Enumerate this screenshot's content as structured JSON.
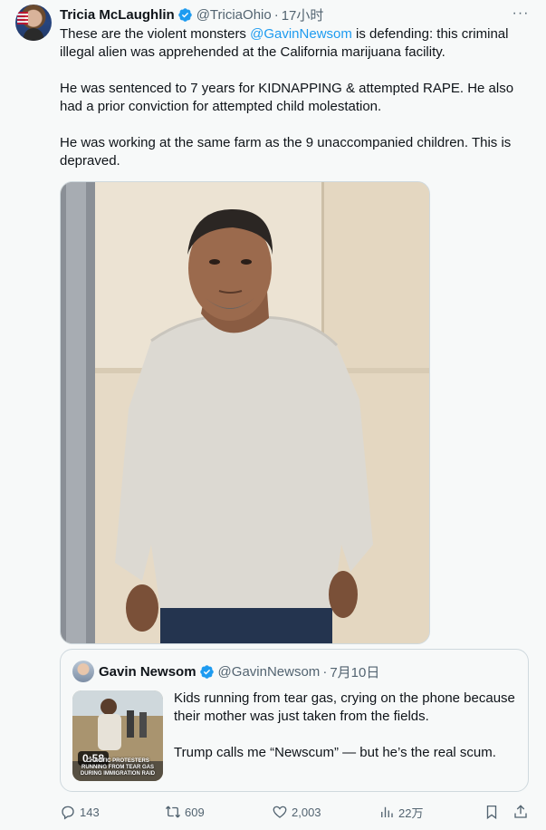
{
  "tweet": {
    "author_name": "Tricia McLaughlin",
    "handle": "@TriciaOhio",
    "separator": "·",
    "time": "17小时",
    "more_label": "···",
    "text_part1": "These are the violent monsters ",
    "mention": "@GavinNewsom",
    "text_part2": " is defending: this criminal illegal alien was apprehended at the California  marijuana facility.",
    "paragraph2": "He was sentenced to 7 years for KIDNAPPING & attempted RAPE. He also had a prior conviction for attempted child molestation.",
    "paragraph3": "He was working at the same farm as the 9 unaccompanied children. This is depraved."
  },
  "quote": {
    "author_name": "Gavin Newsom",
    "handle": "@GavinNewsom",
    "separator": "·",
    "time": "7月10日",
    "video_duration": "0:58",
    "video_caption": "CHAOTIC PROTESTERS RUNNING FROM TEAR GAS DURING IMMIGRATION RAID",
    "paragraph1": "Kids running from tear gas, crying on the phone because their mother was just taken from the fields.",
    "paragraph2": "Trump calls me “Newscum” — but he’s the real scum."
  },
  "actions": {
    "replies": "143",
    "reposts": "609",
    "likes": "2,003",
    "views": "22万"
  },
  "colors": {
    "link": "#1d9bf0",
    "verified": "#1d9bf0",
    "secondary_text": "#536471"
  }
}
